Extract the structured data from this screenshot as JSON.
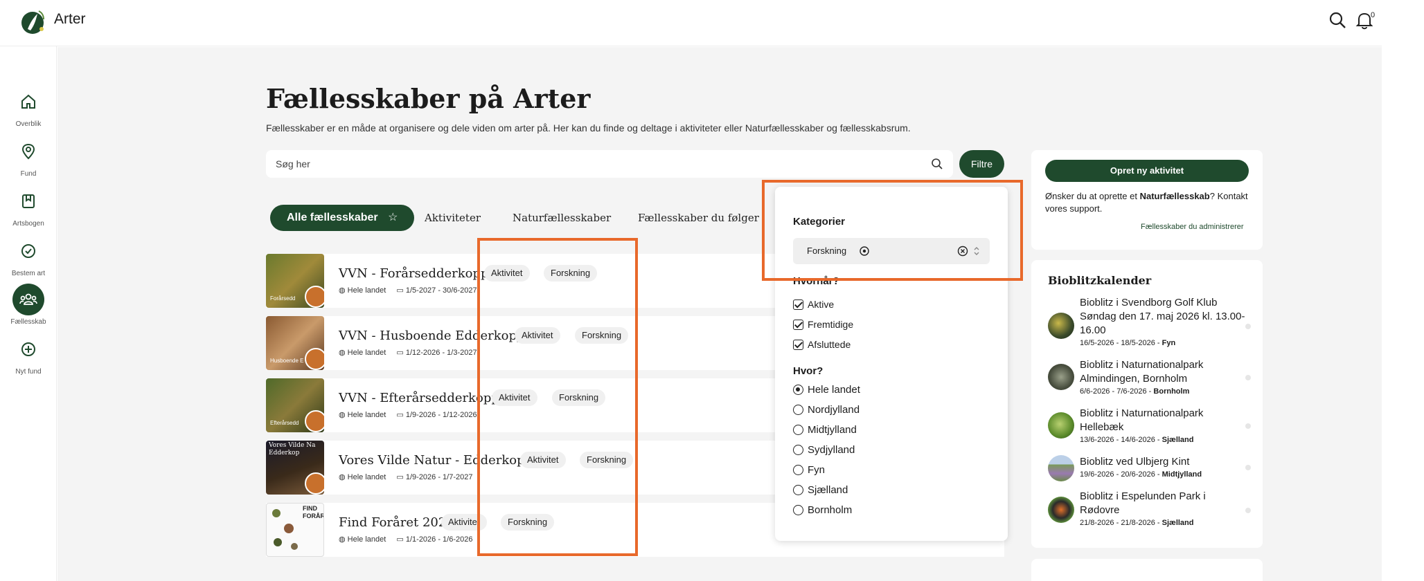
{
  "header": {
    "app_title": "Arter",
    "notification_count": "0"
  },
  "sidebar": {
    "items": [
      {
        "label": "Overblik",
        "icon": "home-icon"
      },
      {
        "label": "Fund",
        "icon": "map-pin-icon"
      },
      {
        "label": "Artsbogen",
        "icon": "book-icon"
      },
      {
        "label": "Bestem art",
        "icon": "check-circle-icon"
      },
      {
        "label": "Fællesskab",
        "icon": "community-icon",
        "active": true
      },
      {
        "label": "Nyt fund",
        "icon": "plus-circle-icon"
      }
    ]
  },
  "page": {
    "title": "Fællesskaber på Arter",
    "help": "?",
    "intro": "Fællesskaber er en måde at organisere og dele viden om arter på. Her kan du finde og deltage i aktiviteter eller Naturfællesskaber og fællesskabsrum."
  },
  "search": {
    "placeholder": "Søg her",
    "filter_label": "Filtre"
  },
  "tabs": [
    {
      "label": "Alle fællesskaber",
      "active": true
    },
    {
      "label": "Aktiviteter"
    },
    {
      "label": "Naturfællesskaber"
    },
    {
      "label": "Fællesskaber du følger"
    }
  ],
  "rows": [
    {
      "title": "VVN - Forårsedderkopper",
      "tags": [
        "Aktivitet",
        "Forskning"
      ],
      "area": "Hele landet",
      "dates": "1/5-2027 - 30/6-2027",
      "thumb_caption": "Forårsedd"
    },
    {
      "title": "VVN - Husboende Edderkopper",
      "tags": [
        "Aktivitet",
        "Forskning"
      ],
      "area": "Hele landet",
      "dates": "1/12-2026 - 1/3-2027",
      "thumb_caption": "Husboende E"
    },
    {
      "title": "VVN - Efterårsedderkopper",
      "tags": [
        "Aktivitet",
        "Forskning"
      ],
      "area": "Hele landet",
      "dates": "1/9-2026 - 1/12-2026",
      "thumb_caption": "Efterårsedd"
    },
    {
      "title": "Vores Vilde Natur - Edderkopper",
      "tags": [
        "Aktivitet",
        "Forskning"
      ],
      "area": "Hele landet",
      "dates": "1/9-2026 - 1/7-2027",
      "thumb_caption": "Vores Vilde Na Edderkop"
    },
    {
      "title": "Find Foråret 2026",
      "tags": [
        "Aktivitet",
        "Forskning"
      ],
      "area": "Hele landet",
      "dates": "1/1-2026 - 1/6-2026",
      "thumb_caption": "FIND FORÅRE"
    }
  ],
  "filter_popup": {
    "categories_heading": "Kategorier",
    "selected_category": "Forskning",
    "when_heading": "Hvornår?",
    "when_options": [
      "Aktive",
      "Fremtidige",
      "Afsluttede"
    ],
    "where_heading": "Hvor?",
    "where_options": [
      "Hele landet",
      "Nordjylland",
      "Midtjylland",
      "Sydjylland",
      "Fyn",
      "Sjælland",
      "Bornholm"
    ],
    "where_selected": "Hele landet"
  },
  "right_panel": {
    "create_button": "Opret ny aktivitet",
    "info_prefix": "Ønsker du at oprette et ",
    "info_bold": "Naturfællesskab",
    "info_suffix": "? Kontakt vores support.",
    "admin_link": "Fællesskaber du administrerer",
    "calendar_title": "Bioblitzkalender",
    "events": [
      {
        "name": "Bioblitz i Svendborg Golf Klub Søndag den 17. maj 2026 kl. 13.00-16.00",
        "dates": "16/5-2026 - 18/5-2026 - ",
        "region": "Fyn"
      },
      {
        "name": "Bioblitz i Naturnationalpark Almindingen, Bornholm",
        "dates": "6/6-2026 - 7/6-2026 - ",
        "region": "Bornholm"
      },
      {
        "name": "Bioblitz i Naturnationalpark Hellebæk",
        "dates": "13/6-2026 - 14/6-2026 - ",
        "region": "Sjælland"
      },
      {
        "name": "Bioblitz ved Ulbjerg Kint",
        "dates": "19/6-2026 - 20/6-2026 - ",
        "region": "Midtjylland"
      },
      {
        "name": "Bioblitz i Espelunden Park i Rødovre",
        "dates": "21/8-2026 - 21/8-2026 - ",
        "region": "Sjælland"
      }
    ]
  },
  "colors": {
    "brand_green": "#1f4a2d",
    "annotation_orange": "#e8692b",
    "background": "#f4f4f4"
  }
}
